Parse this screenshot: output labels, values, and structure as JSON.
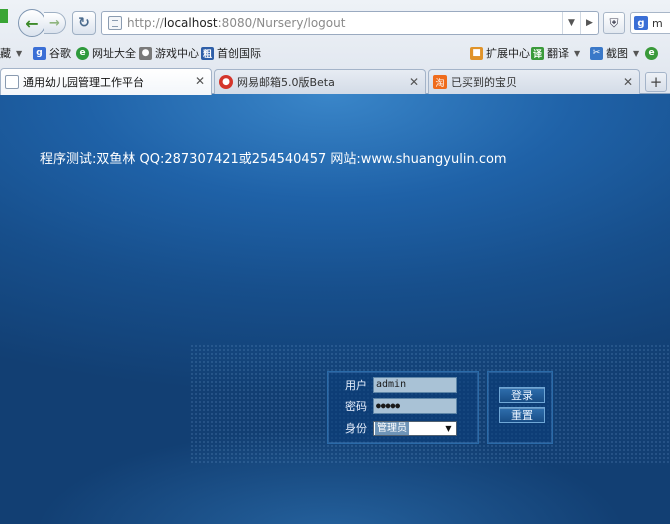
{
  "browser": {
    "url_prefix": "http://",
    "url_host": "localhost",
    "url_rest": ":8080/Nursery/logout",
    "search_text": "m",
    "bookmarks_left": [
      {
        "label": "藏",
        "icon": "",
        "color": ""
      },
      {
        "label": "谷歌",
        "icon": "g-icon",
        "color": "#3b6fd6"
      },
      {
        "label": "网址大全",
        "icon": "globe-icon",
        "color": "#2e9a3c"
      },
      {
        "label": "游戏中心",
        "icon": "gamepad-icon",
        "color": "#6a6a6a"
      },
      {
        "label": "首创国际",
        "icon": "brand-icon",
        "color": "#2f5fa8"
      }
    ],
    "bookmarks_right": [
      {
        "label": "扩展中心",
        "icon": "cube-icon",
        "color": "#e0932a"
      },
      {
        "label": "翻译",
        "icon": "translate-icon",
        "color": "#3a9a3a"
      },
      {
        "label": "截图",
        "icon": "screenshot-icon",
        "color": "#3a78c8"
      }
    ],
    "tabs": [
      {
        "label": "通用幼儿园管理工作平台",
        "icon": "page-icon",
        "active": true
      },
      {
        "label": "网易邮箱5.0版Beta",
        "icon": "mail-icon",
        "active": false
      },
      {
        "label": "已买到的宝贝",
        "icon": "taobao-icon",
        "active": false
      }
    ]
  },
  "page": {
    "info_line": "程序测试:双鱼林 QQ:287307421或254540457  网站:www.shuangyulin.com",
    "login": {
      "user_label": "用户",
      "user_value": "admin",
      "password_label": "密码",
      "password_value": "●●●●●",
      "role_label": "身份",
      "role_value": "管理员",
      "login_button": "登录",
      "reset_button": "重置"
    }
  },
  "colors": {
    "page_background": "#1c4f8a",
    "accent_green": "#3d8a2a"
  }
}
